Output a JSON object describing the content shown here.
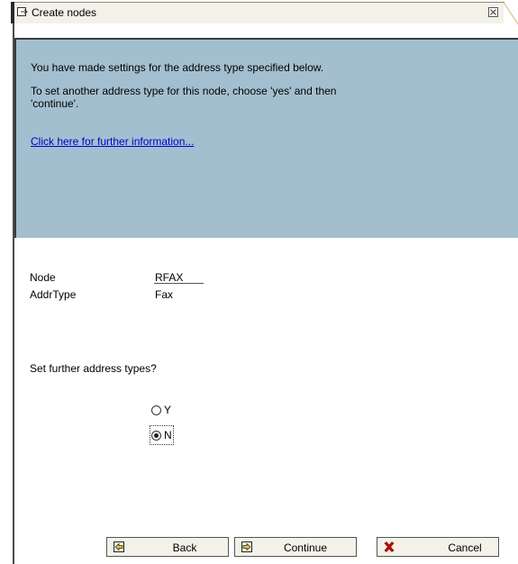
{
  "window": {
    "title": "Create nodes",
    "close_label": "×"
  },
  "info": {
    "line1": "You have made settings for the address type specified below.",
    "line2": "To set another address type for this node, choose 'yes' and then",
    "line3": "'continue'.",
    "link": "Click here for further information..."
  },
  "fields": [
    {
      "label": "Node",
      "value": "RFAX"
    },
    {
      "label": "AddrType",
      "value": "Fax"
    }
  ],
  "question": "Set further address types?",
  "radio": {
    "options": [
      {
        "label": "Y",
        "checked": false
      },
      {
        "label": "N",
        "checked": true
      }
    ]
  },
  "buttons": {
    "back": "Back",
    "continue": "Continue",
    "cancel": "Cancel"
  },
  "colors": {
    "info_bg": "#a3bfcf",
    "link": "#0000cc",
    "button_bg": "#f3f1e8",
    "cancel_icon": "#cc0000"
  }
}
